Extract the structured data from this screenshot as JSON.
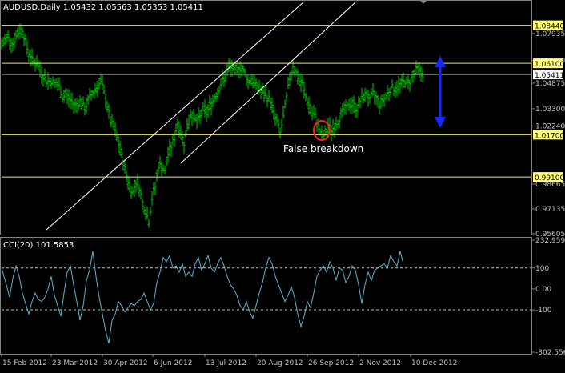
{
  "chart_data": [
    {
      "type": "ohlc",
      "panel": "price",
      "title": "AUDUSD,Daily  1.05432 1.05563 1.05353 1.05411",
      "symbol": "AUDUSD",
      "timeframe": "Daily",
      "last_ohlc": {
        "open": 1.05432,
        "high": 1.05563,
        "low": 1.05353,
        "close": 1.05411
      },
      "ylim": [
        0.95605,
        1.099
      ],
      "yticks": [
        "1.07935",
        "1.06270",
        "1.04875",
        "1.03300",
        "1.02240",
        "0.98665",
        "0.97135",
        "0.95605"
      ],
      "highlighted_levels": [
        "1.08440",
        "1.06100",
        "1.01700",
        "0.99100"
      ],
      "current_price_label": "1.05411",
      "annotation": "False breakdown",
      "bar_color": "#00c800",
      "level_color": "#e8e864",
      "channel_color": "#ffffff",
      "arrow_color": "#1428ff",
      "circle_color": "#ff2020",
      "x_tick_labels": [
        "15 Feb 2012",
        "23 Mar 2012",
        "30 Apr 2012",
        "6 Jun 2012",
        "13 Jul 2012",
        "20 Aug 2012",
        "26 Sep 2012",
        "2 Nov 2012",
        "10 Dec 2012"
      ],
      "close_path": [
        [
          0,
          1.072
        ],
        [
          8,
          1.078
        ],
        [
          14,
          1.073
        ],
        [
          20,
          1.08
        ],
        [
          26,
          1.082
        ],
        [
          32,
          1.07
        ],
        [
          38,
          1.063
        ],
        [
          44,
          1.061
        ],
        [
          50,
          1.055
        ],
        [
          56,
          1.05
        ],
        [
          62,
          1.05
        ],
        [
          68,
          1.048
        ],
        [
          72,
          1.047
        ],
        [
          76,
          1.04
        ],
        [
          80,
          1.042
        ],
        [
          86,
          1.038
        ],
        [
          92,
          1.035
        ],
        [
          98,
          1.038
        ],
        [
          104,
          1.033
        ],
        [
          110,
          1.04
        ],
        [
          116,
          1.045
        ],
        [
          120,
          1.047
        ],
        [
          124,
          1.05
        ],
        [
          128,
          1.043
        ],
        [
          132,
          1.035
        ],
        [
          136,
          1.025
        ],
        [
          140,
          1.022
        ],
        [
          144,
          1.015
        ],
        [
          148,
          1.008
        ],
        [
          152,
          1.0
        ],
        [
          156,
          0.992
        ],
        [
          160,
          0.985
        ],
        [
          164,
          0.982
        ],
        [
          168,
          0.988
        ],
        [
          172,
          0.985
        ],
        [
          176,
          0.975
        ],
        [
          180,
          0.97
        ],
        [
          184,
          0.964
        ],
        [
          188,
          0.978
        ],
        [
          192,
          0.985
        ],
        [
          196,
          0.998
        ],
        [
          200,
          0.998
        ],
        [
          204,
          0.994
        ],
        [
          208,
          1.005
        ],
        [
          212,
          1.01
        ],
        [
          216,
          1.015
        ],
        [
          220,
          1.025
        ],
        [
          224,
          1.018
        ],
        [
          228,
          1.012
        ],
        [
          232,
          1.022
        ],
        [
          236,
          1.03
        ],
        [
          240,
          1.028
        ],
        [
          244,
          1.025
        ],
        [
          248,
          1.028
        ],
        [
          252,
          1.033
        ],
        [
          256,
          1.03
        ],
        [
          260,
          1.035
        ],
        [
          264,
          1.038
        ],
        [
          268,
          1.042
        ],
        [
          272,
          1.046
        ],
        [
          276,
          1.05
        ],
        [
          280,
          1.053
        ],
        [
          284,
          1.058
        ],
        [
          288,
          1.058
        ],
        [
          292,
          1.055
        ],
        [
          296,
          1.059
        ],
        [
          300,
          1.058
        ],
        [
          304,
          1.055
        ],
        [
          308,
          1.05
        ],
        [
          312,
          1.052
        ],
        [
          316,
          1.048
        ],
        [
          320,
          1.047
        ],
        [
          324,
          1.044
        ],
        [
          328,
          1.042
        ],
        [
          332,
          1.04
        ],
        [
          336,
          1.038
        ],
        [
          340,
          1.03
        ],
        [
          344,
          1.025
        ],
        [
          348,
          1.018
        ],
        [
          352,
          1.028
        ],
        [
          356,
          1.04
        ],
        [
          360,
          1.052
        ],
        [
          364,
          1.06
        ],
        [
          368,
          1.055
        ],
        [
          372,
          1.05
        ],
        [
          376,
          1.048
        ],
        [
          380,
          1.04
        ],
        [
          384,
          1.035
        ],
        [
          388,
          1.03
        ],
        [
          392,
          1.028
        ],
        [
          396,
          1.022
        ],
        [
          400,
          1.016
        ],
        [
          404,
          1.017
        ],
        [
          408,
          1.022
        ],
        [
          412,
          1.02
        ],
        [
          416,
          1.022
        ],
        [
          420,
          1.025
        ],
        [
          424,
          1.03
        ],
        [
          428,
          1.032
        ],
        [
          432,
          1.034
        ],
        [
          436,
          1.036
        ],
        [
          440,
          1.035
        ],
        [
          444,
          1.033
        ],
        [
          448,
          1.038
        ],
        [
          452,
          1.04
        ],
        [
          456,
          1.043
        ],
        [
          460,
          1.038
        ],
        [
          464,
          1.042
        ],
        [
          468,
          1.04
        ],
        [
          472,
          1.036
        ],
        [
          476,
          1.038
        ],
        [
          480,
          1.041
        ],
        [
          484,
          1.044
        ],
        [
          488,
          1.046
        ],
        [
          492,
          1.045
        ],
        [
          496,
          1.047
        ],
        [
          500,
          1.049
        ],
        [
          504,
          1.05
        ],
        [
          508,
          1.048
        ],
        [
          512,
          1.052
        ],
        [
          516,
          1.055
        ],
        [
          520,
          1.058
        ],
        [
          524,
          1.055
        ],
        [
          527,
          1.054
        ]
      ]
    },
    {
      "type": "line",
      "panel": "indicator",
      "title": "CCI(20) 101.5853",
      "indicator": "CCI",
      "period": 20,
      "current_value": 101.5853,
      "ylim": [
        -302.556,
        232.9599
      ],
      "yticks": [
        "232.9599",
        "100",
        "0.00",
        "-100",
        "-302.556"
      ],
      "reference_levels": [
        100,
        -100
      ],
      "line_color": "#5fb4c8",
      "x": [
        0,
        6,
        10,
        14,
        18,
        22,
        26,
        30,
        34,
        38,
        42,
        46,
        50,
        54,
        58,
        62,
        66,
        70,
        74,
        78,
        82,
        86,
        90,
        94,
        98,
        102,
        106,
        110,
        114,
        118,
        122,
        126,
        130,
        134,
        138,
        142,
        146,
        150,
        154,
        158,
        162,
        166,
        170,
        174,
        178,
        182,
        186,
        190,
        194,
        198,
        202,
        206,
        210,
        214,
        218,
        222,
        226,
        230,
        234,
        238,
        242,
        246,
        250,
        254,
        258,
        262,
        266,
        270,
        274,
        278,
        282,
        286,
        290,
        294,
        298,
        302,
        306,
        310,
        314,
        318,
        322,
        326,
        330,
        334,
        338,
        342,
        346,
        350,
        354,
        358,
        362,
        366,
        370,
        374,
        378,
        382,
        386,
        390,
        394,
        398,
        402,
        406,
        410,
        414,
        418,
        422,
        426,
        430,
        434,
        438,
        442,
        446,
        450,
        454,
        458,
        462,
        466,
        470,
        474,
        478,
        482,
        486,
        490,
        494,
        498,
        502,
        506,
        510,
        514,
        518,
        522,
        526
      ],
      "values": [
        100,
        20,
        -40,
        50,
        110,
        60,
        -20,
        -70,
        -120,
        -60,
        -20,
        -50,
        -60,
        -40,
        0,
        60,
        -30,
        -80,
        -130,
        -20,
        80,
        110,
        20,
        -60,
        -150,
        -80,
        40,
        90,
        180,
        60,
        -40,
        -120,
        -200,
        -260,
        -150,
        -120,
        -60,
        -80,
        -110,
        -90,
        -70,
        -80,
        -60,
        -50,
        -20,
        -60,
        -100,
        -70,
        30,
        80,
        150,
        130,
        160,
        100,
        110,
        80,
        120,
        60,
        80,
        60,
        120,
        150,
        90,
        120,
        160,
        100,
        80,
        120,
        150,
        110,
        60,
        20,
        0,
        -30,
        -80,
        -100,
        -60,
        -110,
        -140,
        -80,
        -20,
        30,
        100,
        150,
        120,
        60,
        20,
        -20,
        -60,
        -30,
        10,
        -40,
        -120,
        -180,
        -130,
        -60,
        -90,
        -20,
        60,
        90,
        110,
        80,
        130,
        100,
        40,
        100,
        90,
        30,
        60,
        110,
        90,
        20,
        -70,
        20,
        80,
        40,
        90,
        100,
        110,
        120,
        100,
        160,
        130,
        110,
        180,
        120
      ],
      "x_tick_labels": [
        "15 Feb 2012",
        "23 Mar 2012",
        "30 Apr 2012",
        "6 Jun 2012",
        "13 Jul 2012",
        "20 Aug 2012",
        "26 Sep 2012",
        "2 Nov 2012",
        "10 Dec 2012"
      ]
    }
  ]
}
